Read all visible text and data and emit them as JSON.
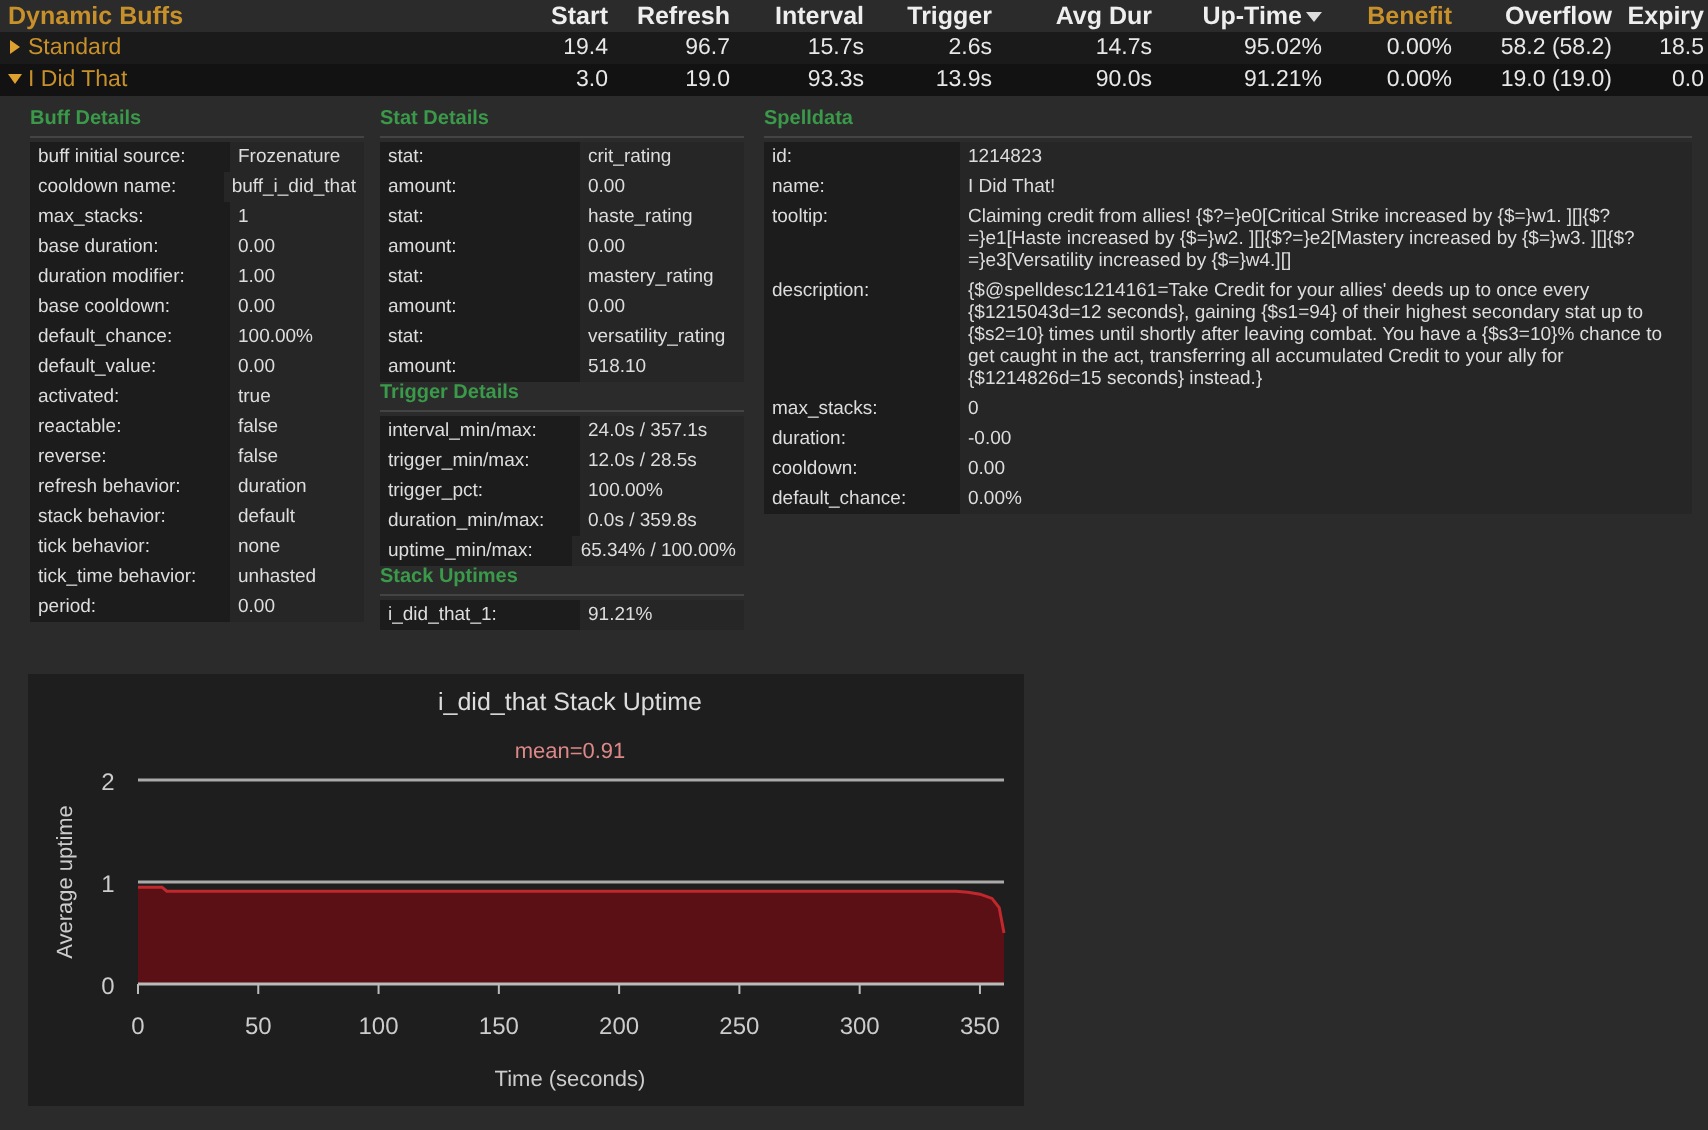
{
  "table": {
    "title": "Dynamic Buffs",
    "columns": [
      {
        "label": "Start",
        "highlight": false,
        "sorted": false
      },
      {
        "label": "Refresh",
        "highlight": false,
        "sorted": false
      },
      {
        "label": "Interval",
        "highlight": false,
        "sorted": false
      },
      {
        "label": "Trigger",
        "highlight": false,
        "sorted": false
      },
      {
        "label": "Avg Dur",
        "highlight": false,
        "sorted": false
      },
      {
        "label": "Up-Time",
        "highlight": false,
        "sorted": true
      },
      {
        "label": "Benefit",
        "highlight": true,
        "sorted": false
      },
      {
        "label": "Overflow",
        "highlight": false,
        "sorted": false
      },
      {
        "label": "Expiry",
        "highlight": false,
        "sorted": false
      }
    ],
    "rows": [
      {
        "name": "Standard",
        "expanded": false,
        "cells": [
          "19.4",
          "96.7",
          "15.7s",
          "2.6s",
          "14.7s",
          "95.02%",
          "0.00%",
          "58.2 (58.2)",
          "18.5"
        ]
      },
      {
        "name": "I Did That",
        "expanded": true,
        "cells": [
          "3.0",
          "19.0",
          "93.3s",
          "13.9s",
          "90.0s",
          "91.21%",
          "0.00%",
          "19.0 (19.0)",
          "0.0"
        ]
      }
    ]
  },
  "buff_details": {
    "title": "Buff Details",
    "rows": [
      [
        "buff initial source:",
        "Frozenature"
      ],
      [
        "cooldown name:",
        "buff_i_did_that"
      ],
      [
        "max_stacks:",
        "1"
      ],
      [
        "base duration:",
        "0.00"
      ],
      [
        "duration modifier:",
        "1.00"
      ],
      [
        "base cooldown:",
        "0.00"
      ],
      [
        "default_chance:",
        "100.00%"
      ],
      [
        "default_value:",
        "0.00"
      ],
      [
        "activated:",
        "true"
      ],
      [
        "reactable:",
        "false"
      ],
      [
        "reverse:",
        "false"
      ],
      [
        "refresh behavior:",
        "duration"
      ],
      [
        "stack behavior:",
        "default"
      ],
      [
        "tick behavior:",
        "none"
      ],
      [
        "tick_time behavior:",
        "unhasted"
      ],
      [
        "period:",
        "0.00"
      ]
    ]
  },
  "stat_details": {
    "title": "Stat Details",
    "rows": [
      [
        "stat:",
        "crit_rating"
      ],
      [
        "amount:",
        "0.00"
      ],
      [
        "stat:",
        "haste_rating"
      ],
      [
        "amount:",
        "0.00"
      ],
      [
        "stat:",
        "mastery_rating"
      ],
      [
        "amount:",
        "0.00"
      ],
      [
        "stat:",
        "versatility_rating"
      ],
      [
        "amount:",
        "518.10"
      ]
    ]
  },
  "trigger_details": {
    "title": "Trigger Details",
    "rows": [
      [
        "interval_min/max:",
        "24.0s / 357.1s"
      ],
      [
        "trigger_min/max:",
        "12.0s / 28.5s"
      ],
      [
        "trigger_pct:",
        "100.00%"
      ],
      [
        "duration_min/max:",
        "0.0s / 359.8s"
      ],
      [
        "uptime_min/max:",
        "65.34% / 100.00%"
      ]
    ]
  },
  "stack_uptimes": {
    "title": "Stack Uptimes",
    "rows": [
      [
        "i_did_that_1:",
        "91.21%"
      ]
    ]
  },
  "spelldata": {
    "title": "Spelldata",
    "rows": [
      [
        "id:",
        "1214823"
      ],
      [
        "name:",
        "I Did That!"
      ],
      [
        "tooltip:",
        "Claiming credit from allies! {$?=}e0[Critical Strike increased by {$=}w1. ][]{$?=}e1[Haste increased by {$=}w2. ][]{$?=}e2[Mastery increased by {$=}w3. ][]{$?=}e3[Versatility increased by {$=}w4.][]"
      ],
      [
        "description:",
        "{$@spelldesc1214161=Take Credit for your allies' deeds up to once every {$1215043d=12 seconds}, gaining {$s1=94} of their highest secondary stat up to {$s2=10} times until shortly after leaving combat. You have a {$s3=10}% chance to get caught in the act, transferring all accumulated Credit to your ally for {$1214826d=15 seconds} instead.}"
      ],
      [
        "max_stacks:",
        "0"
      ],
      [
        "duration:",
        "-0.00"
      ],
      [
        "cooldown:",
        "0.00"
      ],
      [
        "default_chance:",
        "0.00%"
      ]
    ]
  },
  "chart_data": {
    "type": "area",
    "title": "i_did_that Stack Uptime",
    "xlabel": "Time (seconds)",
    "ylabel": "Average uptime",
    "x": [
      0,
      5,
      10,
      12,
      50,
      100,
      150,
      200,
      250,
      300,
      340,
      345,
      350,
      355,
      358,
      360
    ],
    "series": [
      {
        "color": "#c0282d",
        "values": [
          0.95,
          0.95,
          0.95,
          0.91,
          0.91,
          0.91,
          0.91,
          0.91,
          0.91,
          0.91,
          0.91,
          0.9,
          0.88,
          0.84,
          0.75,
          0.5
        ]
      }
    ],
    "xlim": [
      0,
      360
    ],
    "ylim": [
      0,
      2
    ],
    "xticks": [
      0,
      50,
      100,
      150,
      200,
      250,
      300,
      350
    ],
    "yticks": [
      0,
      1,
      2
    ],
    "stacked": false
  },
  "chart_subtitle": "mean=0.91"
}
